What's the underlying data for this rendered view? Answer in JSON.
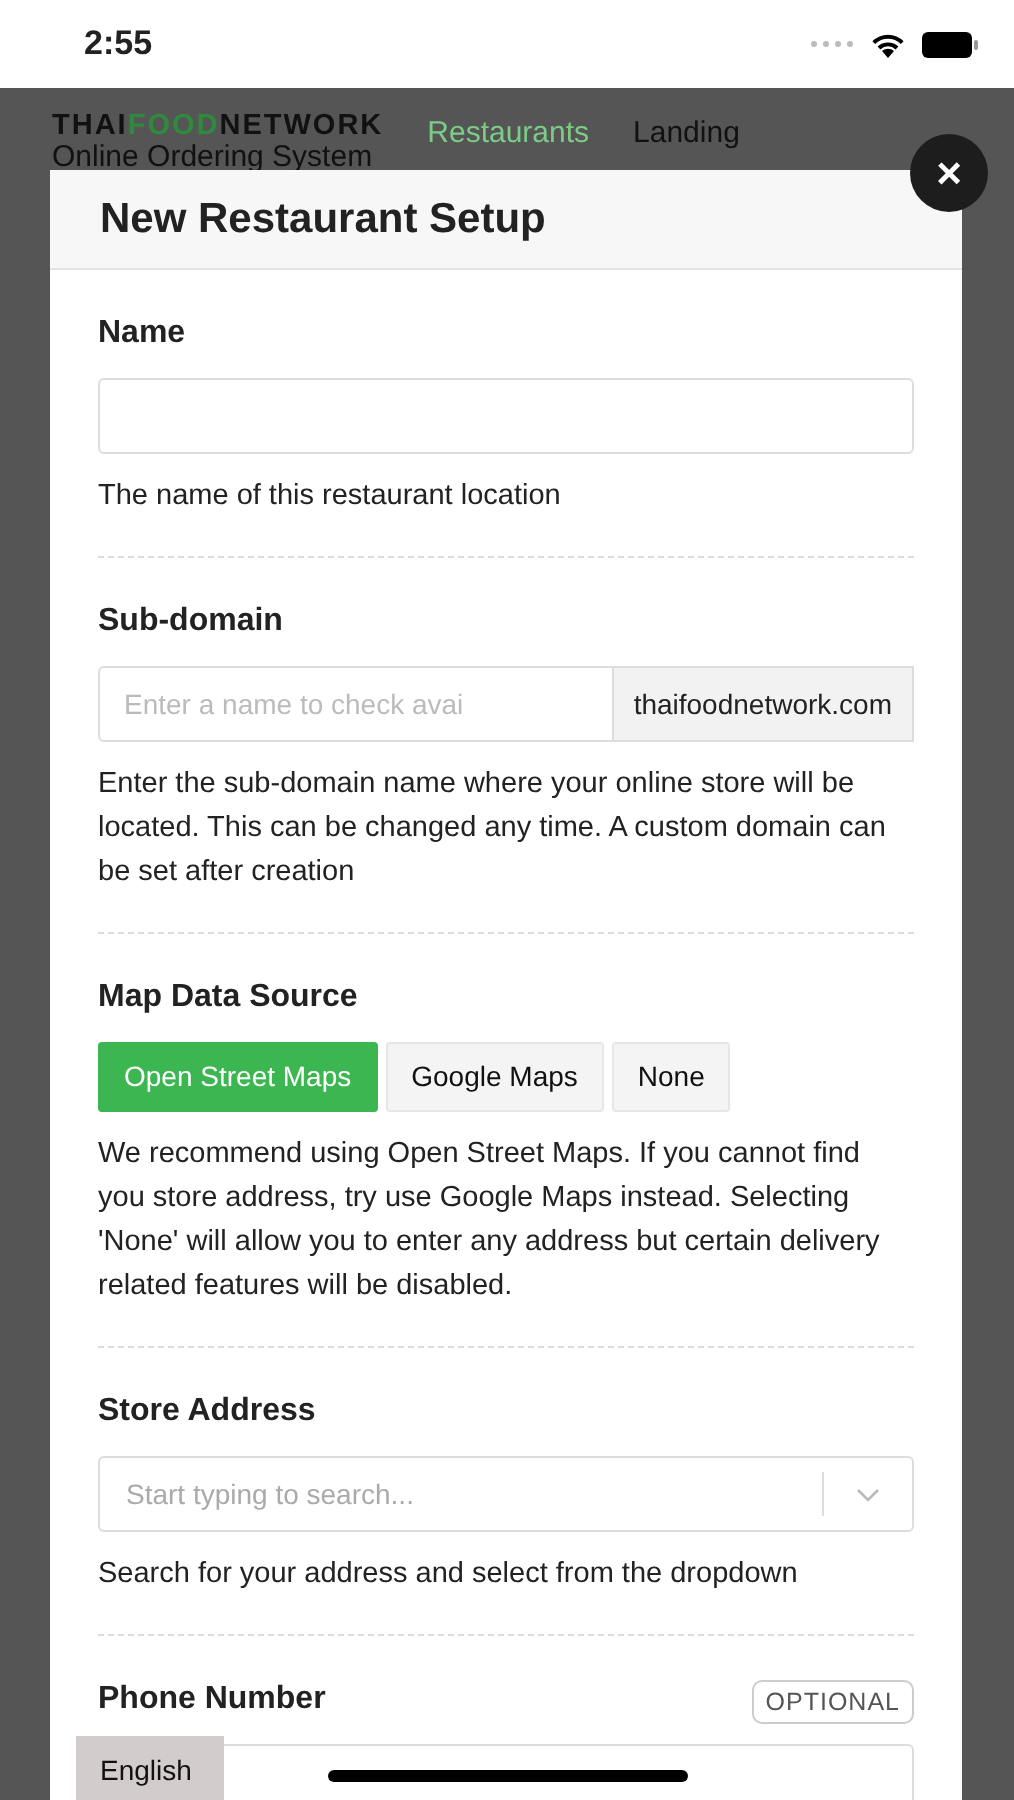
{
  "status_bar": {
    "time": "2:55"
  },
  "background_page": {
    "brand": [
      {
        "text": "THAI",
        "highlight": false
      },
      {
        "text": "FOOD",
        "highlight": true
      },
      {
        "text": "NETWORK",
        "highlight": false
      }
    ],
    "subtitle": "Online Ordering System",
    "nav": [
      {
        "label": "Restaurants",
        "selected": true
      },
      {
        "label": "Landing",
        "selected": false
      }
    ]
  },
  "modal": {
    "title": "New Restaurant Setup",
    "close": "×",
    "sections": [
      {
        "kind": "text",
        "label": "Name",
        "help": "The name of this restaurant location"
      },
      {
        "kind": "addon",
        "label": "Sub-domain",
        "placeholder": "Enter a name to check avai",
        "addon": "thaifoodnetwork.com",
        "help": "Enter the sub-domain name where your online store will be located. This can be changed any time. A custom domain can be set after creation"
      },
      {
        "kind": "choice",
        "label": "Map Data Source",
        "options": [
          {
            "label": "Open Street Maps",
            "selected": true
          },
          {
            "label": "Google Maps",
            "selected": false
          },
          {
            "label": "None",
            "selected": false
          }
        ],
        "help": "We recommend using Open Street Maps. If you cannot find you store address, try use Google Maps instead. Selecting 'None' will allow you to enter any address but certain delivery related features will be disabled."
      },
      {
        "kind": "select",
        "label": "Store Address",
        "placeholder": "Start typing to search...",
        "help": "Search for your address and select from the dropdown"
      },
      {
        "kind": "text",
        "label": "Phone Number",
        "badge": "OPTIONAL"
      }
    ]
  },
  "language_tab": "English"
}
